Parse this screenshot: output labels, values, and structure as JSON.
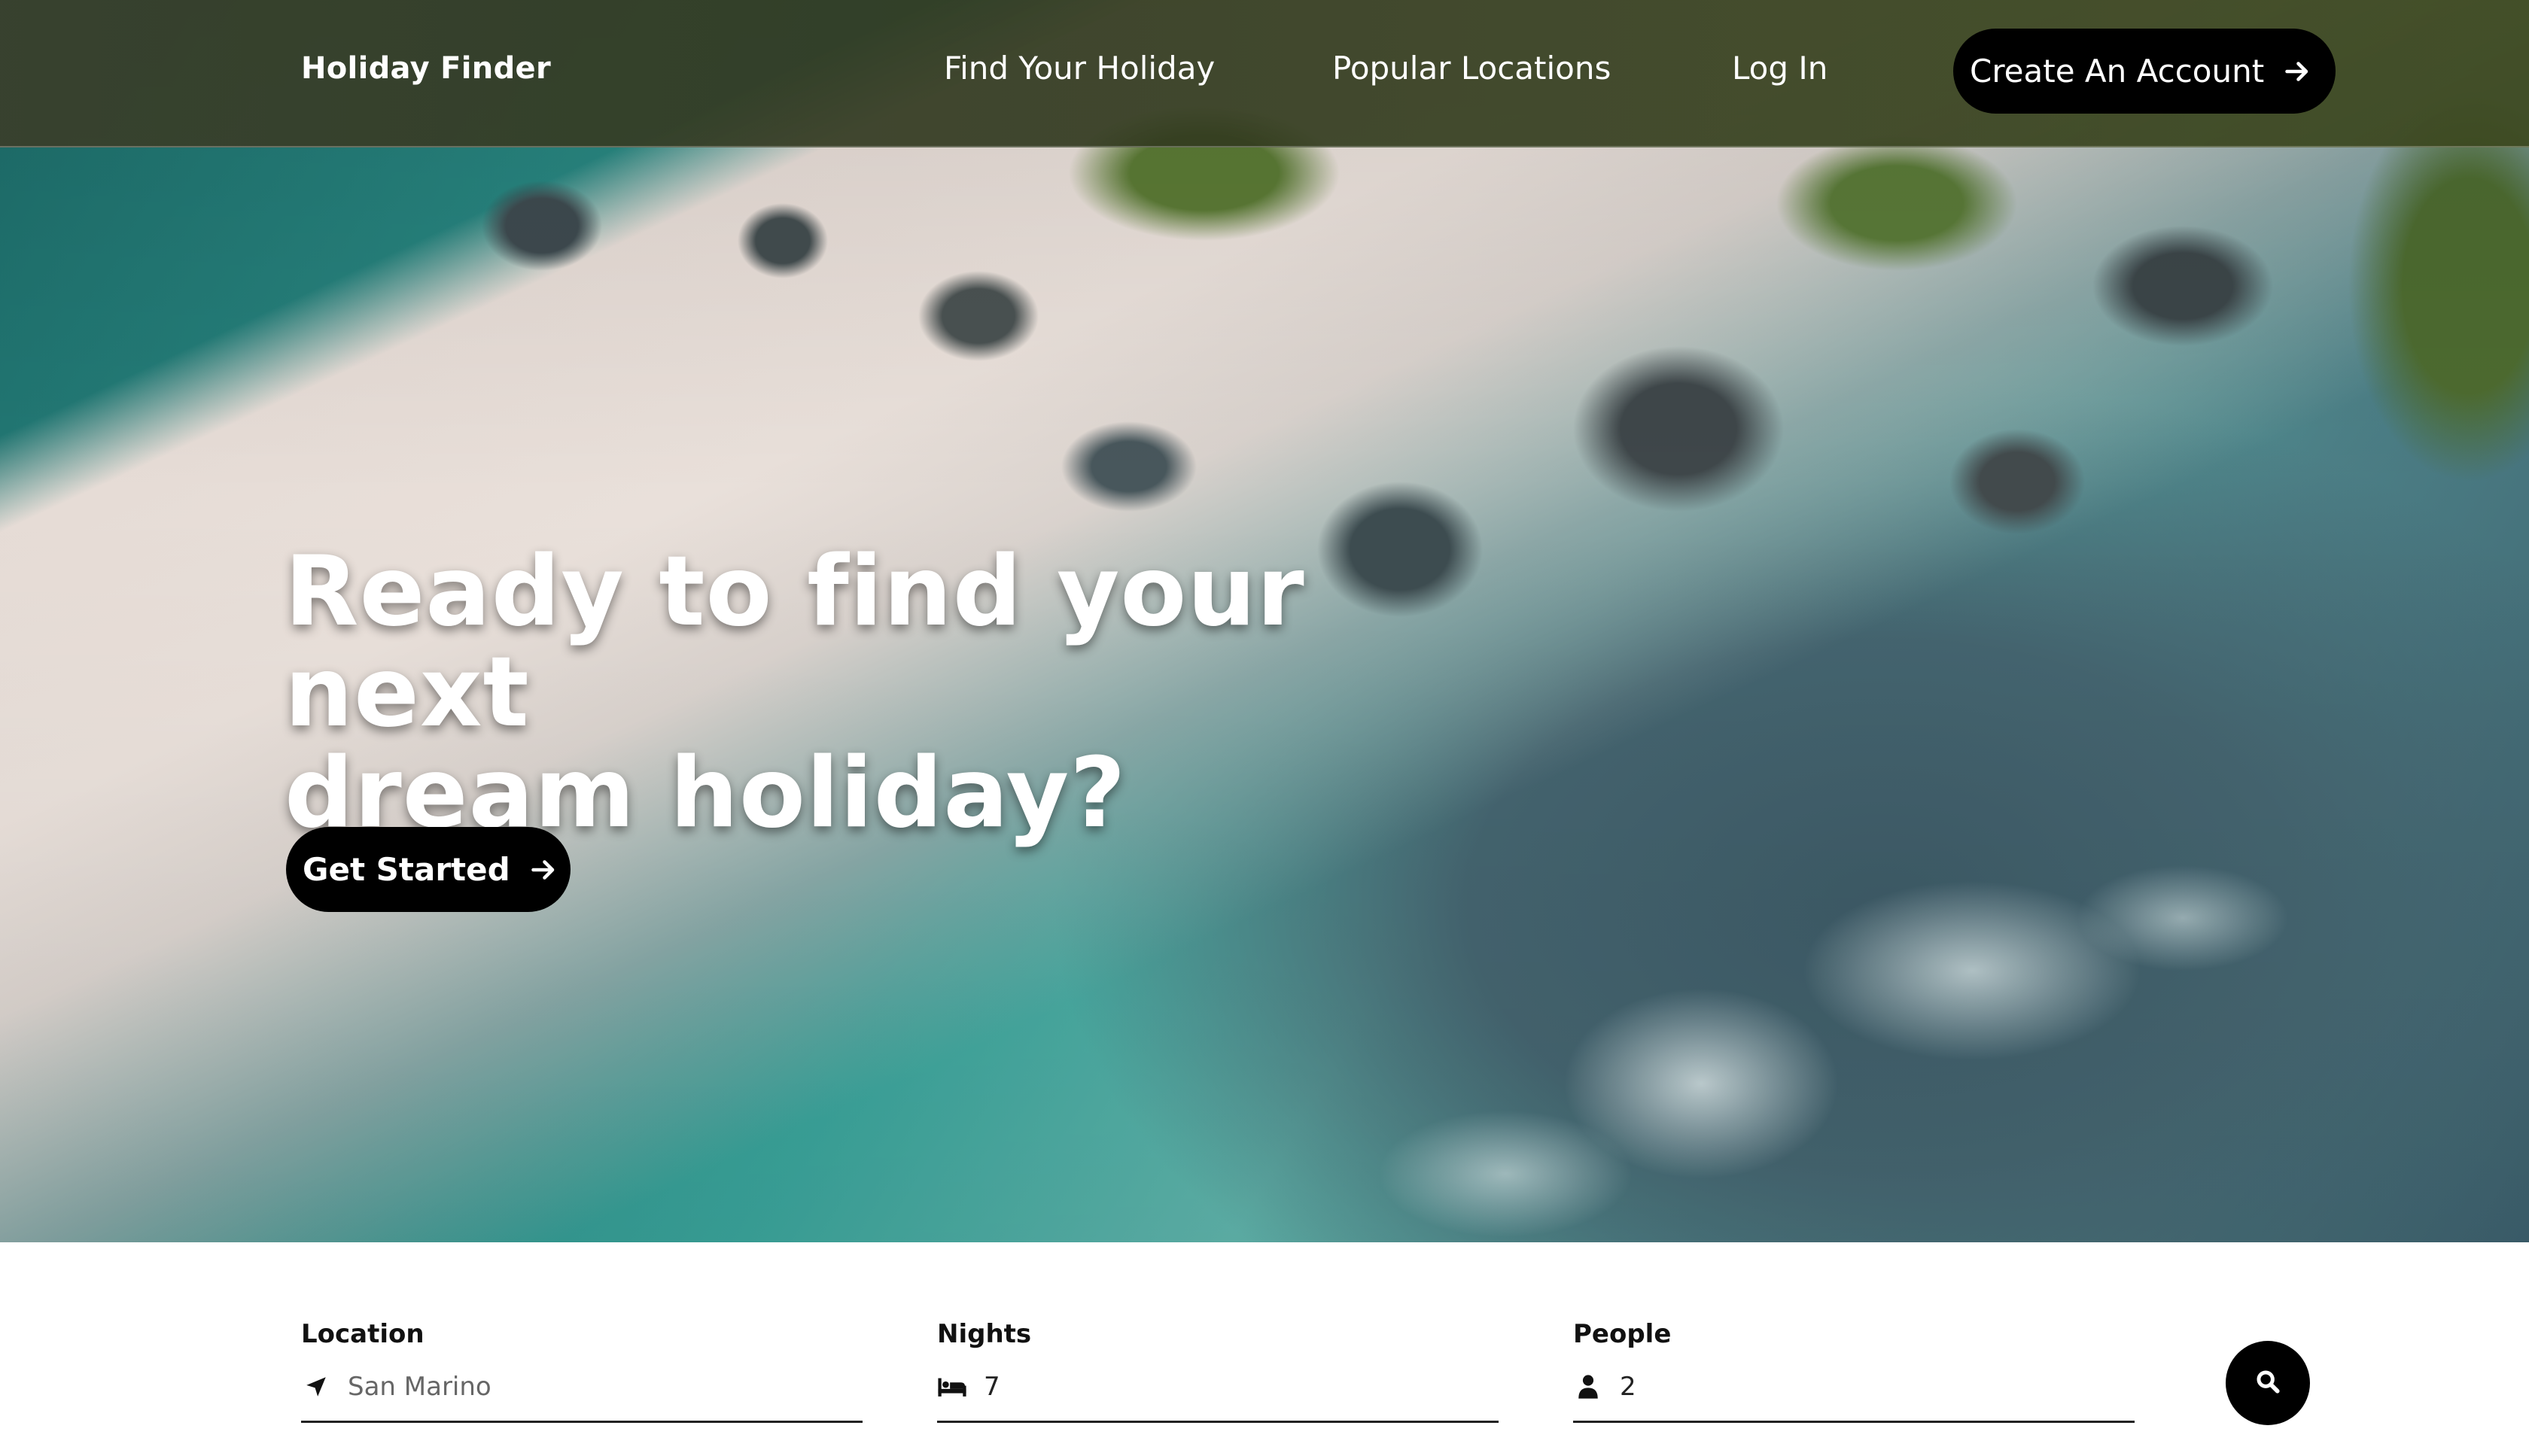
{
  "navbar": {
    "brand": "Holiday Finder",
    "links": [
      "Find Your Holiday",
      "Popular Locations",
      "Log In"
    ],
    "cta_label": "Create An Account"
  },
  "hero": {
    "headline_line1": "Ready to find your next",
    "headline_line2": "dream holiday?",
    "cta_label": "Get Started"
  },
  "search": {
    "location": {
      "label": "Location",
      "placeholder": "San Marino",
      "icon": "location-arrow-icon"
    },
    "nights": {
      "label": "Nights",
      "value": "7",
      "icon": "bed-icon"
    },
    "people": {
      "label": "People",
      "value": "2",
      "icon": "user-icon"
    },
    "submit_icon": "search-icon"
  },
  "colors": {
    "button_bg": "#000000",
    "button_text": "#ffffff",
    "text_dark": "#111111",
    "placeholder": "#666666"
  }
}
